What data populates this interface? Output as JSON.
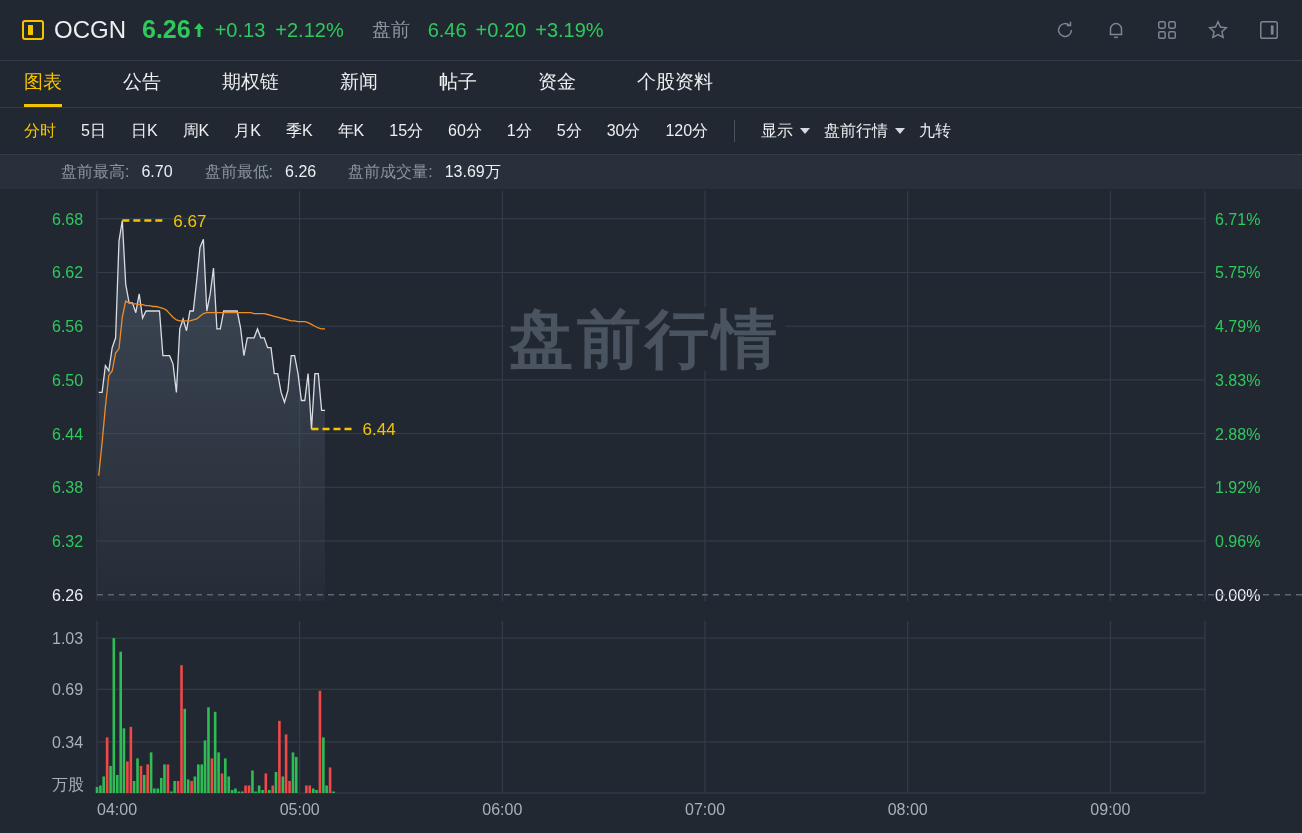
{
  "header": {
    "symbol": "OCGN",
    "price": "6.26",
    "change": "+0.13",
    "change_pct": "+2.12%",
    "premarket_label": "盘前",
    "premarket_price": "6.46",
    "premarket_change": "+0.20",
    "premarket_change_pct": "+3.19%"
  },
  "tabs": [
    {
      "label": "图表",
      "selected": true
    },
    {
      "label": "公告",
      "selected": false
    },
    {
      "label": "期权链",
      "selected": false
    },
    {
      "label": "新闻",
      "selected": false
    },
    {
      "label": "帖子",
      "selected": false
    },
    {
      "label": "资金",
      "selected": false
    },
    {
      "label": "个股资料",
      "selected": false
    }
  ],
  "periods": [
    {
      "label": "分时",
      "selected": true
    },
    {
      "label": "5日",
      "selected": false
    },
    {
      "label": "日K",
      "selected": false
    },
    {
      "label": "周K",
      "selected": false
    },
    {
      "label": "月K",
      "selected": false
    },
    {
      "label": "季K",
      "selected": false
    },
    {
      "label": "年K",
      "selected": false
    },
    {
      "label": "15分",
      "selected": false
    },
    {
      "label": "60分",
      "selected": false
    },
    {
      "label": "1分",
      "selected": false
    },
    {
      "label": "5分",
      "selected": false
    },
    {
      "label": "30分",
      "selected": false
    },
    {
      "label": "120分",
      "selected": false
    }
  ],
  "options": [
    {
      "label": "显示",
      "kind": "dropdown"
    },
    {
      "label": "盘前行情",
      "kind": "dropdown"
    },
    {
      "label": "九转",
      "kind": "plain"
    }
  ],
  "stats": [
    {
      "label": "盘前最高:",
      "value": "6.70"
    },
    {
      "label": "盘前最低:",
      "value": "6.26"
    },
    {
      "label": "盘前成交量:",
      "value": "13.69万"
    }
  ],
  "chart": {
    "watermark_text": "盘前行情",
    "percent_labels": [
      "6.71%",
      "5.75%",
      "4.79%",
      "3.83%",
      "2.88%",
      "1.92%",
      "0.96%",
      "0.00%"
    ],
    "chart_data": {
      "type": "line",
      "grid": true,
      "ylim": [
        6.253,
        6.711
      ],
      "categories": [
        null,
        null,
        null,
        null,
        null,
        null,
        null,
        null,
        null,
        null,
        null,
        null,
        null,
        null,
        null,
        null,
        null,
        null,
        null,
        null,
        null,
        null,
        null,
        null,
        null,
        null,
        null,
        null,
        null,
        null,
        null,
        null,
        null,
        null,
        null,
        null,
        null,
        null,
        null,
        null,
        null,
        null,
        null,
        null,
        null,
        null,
        null,
        null,
        null,
        null,
        null,
        null,
        null,
        null,
        null,
        null,
        null,
        null,
        null,
        null,
        null,
        null,
        null,
        null,
        null,
        null,
        null,
        null,
        null,
        null,
        null,
        null,
        null,
        null,
        null,
        null,
        null,
        null,
        null,
        null,
        null,
        null,
        null,
        null,
        null,
        null,
        null,
        null,
        null,
        null,
        null,
        null,
        null,
        null,
        null,
        null,
        null,
        null,
        null,
        null,
        null,
        null,
        null,
        null,
        null,
        null,
        null,
        null,
        null,
        null,
        null,
        null,
        null,
        null,
        null,
        null,
        null,
        null,
        null,
        null,
        null,
        null,
        null,
        null,
        null,
        null,
        null,
        null,
        null,
        null,
        null,
        null,
        null,
        null,
        null,
        null,
        null,
        null,
        null,
        null,
        null,
        null,
        null,
        null,
        null,
        null,
        null,
        null,
        null,
        null,
        null,
        null,
        null,
        null,
        null,
        null,
        null,
        null,
        null,
        null,
        null,
        null,
        null,
        null,
        null,
        null,
        null,
        null,
        null,
        null,
        null,
        null,
        null,
        null,
        null,
        null,
        null,
        null,
        null,
        null,
        null,
        null,
        null,
        null,
        null,
        null,
        null,
        null,
        null,
        null,
        null,
        null,
        null,
        null,
        null,
        null,
        null,
        null,
        null,
        null,
        null,
        null,
        null,
        null,
        null,
        null,
        null,
        null,
        null,
        null,
        null,
        null,
        null,
        null,
        null,
        null,
        null,
        null,
        null,
        null,
        null,
        null,
        null,
        null,
        null,
        null,
        null,
        null,
        null,
        null,
        null,
        null,
        null,
        null,
        null,
        null,
        null,
        null,
        null,
        null,
        null,
        null,
        null,
        null,
        null,
        null,
        null,
        null,
        null,
        null,
        null,
        null,
        null,
        null,
        null,
        null,
        null,
        null,
        null,
        null,
        null,
        null,
        null,
        null,
        null,
        null,
        null,
        null,
        null,
        null,
        null,
        null,
        null,
        null,
        null,
        null,
        null,
        null,
        null,
        null,
        null,
        null,
        null,
        null,
        null,
        null,
        null,
        null,
        null,
        null,
        null,
        null,
        null,
        null,
        null,
        null,
        null,
        null,
        null,
        null,
        null,
        null,
        null,
        null,
        null,
        null,
        null,
        null,
        null,
        null,
        null,
        null,
        null,
        null,
        null,
        null,
        null,
        null,
        null,
        null,
        null,
        null,
        null,
        null,
        null,
        null,
        null,
        null
      ],
      "yticks": [
        6.68,
        6.62,
        6.56,
        {
          "value": 6.5,
          "label": "6.50"
        },
        6.44,
        6.38,
        6.32,
        6.26
      ],
      "ref_lines": [
        {
          "axis": "y",
          "value": 6.26
        }
      ],
      "series": [
        {
          "type": "area",
          "color": "#d9dde3",
          "values": [
            6.486,
            6.486,
            6.516,
            6.51,
            6.536,
            6.547,
            6.655,
            6.678,
            6.607,
            6.586,
            6.586,
            6.575,
            6.596,
            6.569,
            6.577,
            6.577,
            6.577,
            6.577,
            6.577,
            6.527,
            6.527,
            6.527,
            6.518,
            6.486,
            6.557,
            6.568,
            6.555,
            6.577,
            6.577,
            6.611,
            6.648,
            6.657,
            6.577,
            6.596,
            6.625,
            6.557,
            6.557,
            6.577,
            6.577,
            6.577,
            6.577,
            6.577,
            6.558,
            6.527,
            6.547,
            6.547,
            6.547,
            6.557,
            6.547,
            6.547,
            6.536,
            6.536,
            6.507,
            6.507,
            6.486,
            6.475,
            6.488,
            6.527,
            6.527,
            6.507,
            6.477,
            6.477,
            6.507,
            6.445,
            6.507,
            6.507,
            6.466,
            6.466,
            null,
            null,
            null,
            null,
            null,
            null,
            null,
            null,
            null,
            null,
            null,
            null,
            null,
            null,
            null,
            null,
            null,
            null,
            null,
            null,
            null,
            null,
            null,
            null,
            null,
            null,
            null,
            null,
            null,
            null,
            null,
            null,
            null,
            null,
            null,
            null,
            null,
            null,
            null,
            null,
            null,
            null,
            null,
            null,
            null,
            null,
            null,
            null,
            null,
            null,
            null,
            null,
            null,
            null,
            null,
            null,
            null,
            null,
            null,
            null,
            null,
            null,
            null,
            null,
            null,
            null,
            null,
            null,
            null,
            null,
            null,
            null,
            null,
            null,
            null,
            null,
            null,
            null,
            null,
            null,
            null,
            null,
            null,
            null,
            null,
            null,
            null,
            null,
            null,
            null,
            null,
            null,
            null,
            null,
            null,
            null,
            null,
            null,
            null,
            null,
            null,
            null,
            null,
            null,
            null,
            null,
            null,
            null,
            null,
            null,
            null,
            null,
            null,
            null,
            null,
            null,
            null,
            null,
            null,
            null,
            null,
            null,
            null,
            null,
            null,
            null,
            null,
            null,
            null,
            null,
            null,
            null,
            null,
            null,
            null,
            null,
            null,
            null,
            null,
            null,
            null,
            null,
            null,
            null,
            null,
            null,
            null,
            null,
            null,
            null,
            null,
            null,
            null,
            null,
            null,
            null,
            null,
            null,
            null,
            null,
            null,
            null,
            null,
            null,
            null,
            null,
            null,
            null,
            null,
            null,
            null,
            null,
            null,
            null,
            null,
            null,
            null,
            null,
            null,
            null,
            null,
            null,
            null,
            null,
            null,
            null,
            null,
            null,
            null,
            null,
            null,
            null,
            null,
            null,
            null,
            null,
            null,
            null,
            null,
            null,
            null,
            null,
            null,
            null,
            null,
            null,
            null,
            null,
            null,
            null,
            null,
            null,
            null,
            null,
            null,
            null,
            null,
            null,
            null,
            null,
            null,
            null,
            null,
            null,
            null,
            null,
            null,
            null,
            null,
            null,
            null,
            null,
            null,
            null,
            null,
            null,
            null,
            null,
            null,
            null,
            null,
            null,
            null,
            null,
            null,
            null,
            null,
            null,
            null,
            null,
            null,
            null,
            null,
            null,
            null,
            null,
            null,
            null,
            null,
            null
          ]
        },
        {
          "type": "line",
          "color": "#f08c28",
          "values": [
            6.393,
            6.43,
            6.47,
            6.505,
            6.51,
            6.53,
            6.535,
            6.57,
            6.588,
            6.586,
            6.585,
            6.585,
            6.584,
            6.584,
            6.583,
            6.583,
            6.582,
            6.582,
            6.581,
            6.58,
            6.578,
            6.574,
            6.57,
            6.567,
            6.566,
            6.566,
            6.566,
            6.566,
            6.567,
            6.568,
            6.571,
            6.574,
            6.575,
            6.575,
            6.575,
            6.575,
            6.575,
            6.575,
            6.575,
            6.575,
            6.575,
            6.575,
            6.575,
            6.575,
            6.575,
            6.575,
            6.574,
            6.574,
            6.574,
            6.574,
            6.573,
            6.572,
            6.571,
            6.57,
            6.569,
            6.568,
            6.567,
            6.566,
            6.566,
            6.565,
            6.565,
            6.565,
            6.564,
            6.562,
            6.56,
            6.558,
            6.557,
            6.557,
            null,
            null,
            null,
            null,
            null,
            null,
            null,
            null,
            null,
            null,
            null,
            null,
            null,
            null,
            null,
            null,
            null,
            null,
            null,
            null,
            null,
            null,
            null,
            null,
            null,
            null,
            null,
            null,
            null,
            null,
            null,
            null,
            null,
            null,
            null,
            null,
            null,
            null,
            null,
            null,
            null,
            null,
            null,
            null,
            null,
            null,
            null,
            null,
            null,
            null,
            null,
            null,
            null,
            null,
            null,
            null,
            null,
            null,
            null,
            null,
            null,
            null,
            null,
            null,
            null,
            null,
            null,
            null,
            null,
            null,
            null,
            null,
            null,
            null,
            null,
            null,
            null,
            null,
            null,
            null,
            null,
            null,
            null,
            null,
            null,
            null,
            null,
            null,
            null,
            null,
            null,
            null,
            null,
            null,
            null,
            null,
            null,
            null,
            null,
            null,
            null,
            null,
            null,
            null,
            null,
            null,
            null,
            null,
            null,
            null,
            null,
            null,
            null,
            null,
            null,
            null,
            null,
            null,
            null,
            null,
            null,
            null,
            null,
            null,
            null,
            null,
            null,
            null,
            null,
            null,
            null,
            null,
            null,
            null,
            null,
            null,
            null,
            null,
            null,
            null,
            null,
            null,
            null,
            null,
            null,
            null,
            null,
            null,
            null,
            null,
            null,
            null,
            null,
            null,
            null,
            null,
            null,
            null,
            null,
            null,
            null,
            null,
            null,
            null,
            null,
            null,
            null,
            null,
            null,
            null,
            null,
            null,
            null,
            null,
            null,
            null,
            null,
            null,
            null,
            null,
            null,
            null,
            null,
            null,
            null,
            null,
            null,
            null,
            null,
            null,
            null,
            null,
            null,
            null,
            null,
            null,
            null,
            null,
            null,
            null,
            null,
            null,
            null,
            null,
            null,
            null,
            null,
            null,
            null,
            null,
            null,
            null,
            null,
            null,
            null,
            null,
            null,
            null,
            null,
            null,
            null,
            null,
            null,
            null,
            null,
            null,
            null,
            null,
            null,
            null,
            null,
            null,
            null,
            null,
            null,
            null,
            null,
            null,
            null,
            null,
            null,
            null,
            null,
            null,
            null,
            null,
            null,
            null,
            null,
            null,
            null,
            null,
            null,
            null,
            null,
            null,
            null,
            null,
            null,
            null
          ]
        }
      ],
      "annotations": [
        "6.67",
        "6.44"
      ]
    }
  },
  "volume": {
    "chart_data": {
      "type": "bar",
      "grid": true,
      "ylabel": "万股",
      "xlim": [
        4,
        9.467
      ],
      "ylim": [
        0,
        1.144
      ],
      "yticks": [
        0.34,
        0.69,
        1.03
      ],
      "x": [
        4,
        4.017,
        4.033,
        4.05,
        4.067,
        4.083,
        4.1,
        4.117,
        4.133,
        4.15,
        4.167,
        4.183,
        4.2,
        4.217,
        4.233,
        4.25,
        4.267,
        4.283,
        4.3,
        4.317,
        4.333,
        4.35,
        4.367,
        4.383,
        4.4,
        4.417,
        4.433,
        4.45,
        4.467,
        4.483,
        4.5,
        4.517,
        4.533,
        4.55,
        4.567,
        4.583,
        4.6,
        4.617,
        4.633,
        4.65,
        4.667,
        4.683,
        4.7,
        4.717,
        4.733,
        4.75,
        4.767,
        4.783,
        4.8,
        4.817,
        4.833,
        4.85,
        4.867,
        4.883,
        4.9,
        4.917,
        4.933,
        4.95,
        4.967,
        4.983,
        5.033,
        5.05,
        5.067,
        5.083,
        5.1,
        5.117,
        5.133,
        5.15,
        5.167
      ],
      "xticks": [
        {
          "value": 4,
          "label": "04:00"
        },
        {
          "value": 5,
          "label": "05:00"
        },
        {
          "value": 6,
          "label": "06:00"
        },
        {
          "value": 7,
          "label": "07:00"
        },
        {
          "value": 8,
          "label": "08:00"
        },
        {
          "value": 9,
          "label": "09:00"
        }
      ],
      "series": [
        {
          "color": "#2ebd55",
          "values": [
            0.04,
            0.05,
            0.11,
            null,
            0.18,
            1.03,
            0.12,
            0.94,
            0.43,
            null,
            null,
            0.08,
            0.23,
            null,
            0.12,
            null,
            0.27,
            0.03,
            0.03,
            0.1,
            0.19,
            null,
            0.01,
            0.08,
            null,
            null,
            0.56,
            0.09,
            null,
            0.11,
            0.19,
            0.19,
            0.35,
            0.57,
            null,
            0.54,
            0.27,
            null,
            0.23,
            0.11,
            0.02,
            0.03,
            0.01,
            0.01,
            null,
            null,
            0.15,
            0.01,
            0.05,
            0.02,
            null,
            0.02,
            null,
            0.14,
            null,
            0.11,
            null,
            null,
            0.27,
            0.24,
            null,
            null,
            0.03,
            0.02,
            null,
            0.37,
            0.05,
            null,
            0.01
          ]
        },
        {
          "color": "#f04848",
          "values": [
            null,
            null,
            null,
            0.37,
            null,
            null,
            null,
            null,
            null,
            0.21,
            0.44,
            null,
            null,
            0.18,
            null,
            0.19,
            null,
            null,
            null,
            null,
            null,
            0.19,
            null,
            null,
            0.08,
            0.85,
            null,
            null,
            0.08,
            null,
            null,
            null,
            null,
            null,
            0.23,
            null,
            null,
            0.13,
            null,
            null,
            null,
            null,
            null,
            null,
            0.05,
            0.05,
            null,
            null,
            null,
            null,
            0.13,
            null,
            0.05,
            null,
            0.48,
            null,
            0.39,
            0.08,
            null,
            null,
            0.05,
            0.05,
            null,
            null,
            0.68,
            null,
            null,
            0.17,
            null
          ]
        }
      ]
    }
  }
}
